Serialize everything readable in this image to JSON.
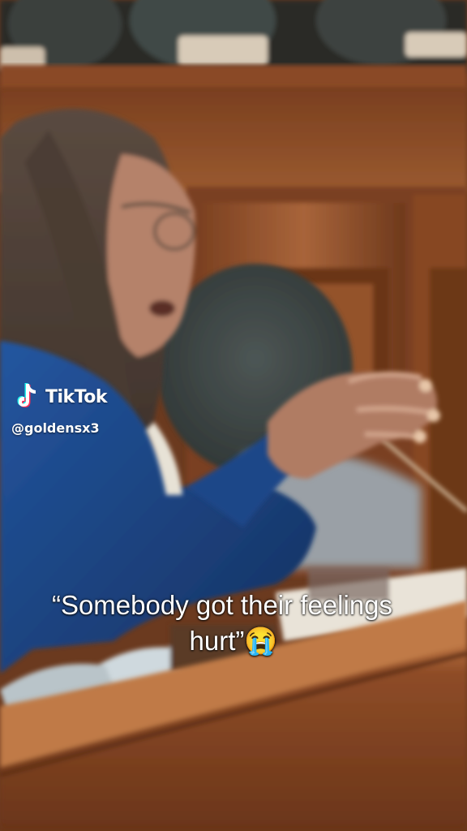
{
  "watermark": {
    "brand": "TikTok",
    "handle": "@goldensx3",
    "logo_icon": "tiktok-note-icon"
  },
  "caption": {
    "line1": "“Somebody got their feelings",
    "line2": "hurt”😭"
  },
  "colors": {
    "wood_dark": "#5a2e18",
    "wood_mid": "#8a4a26",
    "wood_light": "#b8703f",
    "jacket_blue": "#1d3f7a",
    "chair_gray": "#3f4746",
    "tiktok_cyan": "#25f4ee",
    "tiktok_red": "#fe2c55"
  }
}
